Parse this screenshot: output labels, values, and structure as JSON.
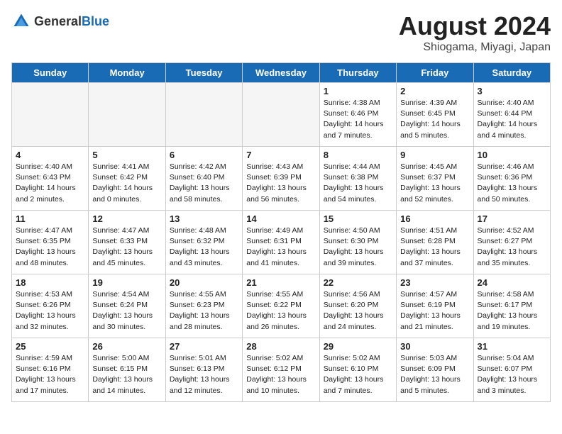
{
  "header": {
    "logo_general": "General",
    "logo_blue": "Blue",
    "title": "August 2024",
    "subtitle": "Shiogama, Miyagi, Japan"
  },
  "days_of_week": [
    "Sunday",
    "Monday",
    "Tuesday",
    "Wednesday",
    "Thursday",
    "Friday",
    "Saturday"
  ],
  "weeks": [
    [
      {
        "day": "",
        "empty": true
      },
      {
        "day": "",
        "empty": true
      },
      {
        "day": "",
        "empty": true
      },
      {
        "day": "",
        "empty": true
      },
      {
        "day": "1",
        "sunrise": "4:38 AM",
        "sunset": "6:46 PM",
        "daylight": "14 hours and 7 minutes."
      },
      {
        "day": "2",
        "sunrise": "4:39 AM",
        "sunset": "6:45 PM",
        "daylight": "14 hours and 5 minutes."
      },
      {
        "day": "3",
        "sunrise": "4:40 AM",
        "sunset": "6:44 PM",
        "daylight": "14 hours and 4 minutes."
      }
    ],
    [
      {
        "day": "4",
        "sunrise": "4:40 AM",
        "sunset": "6:43 PM",
        "daylight": "14 hours and 2 minutes."
      },
      {
        "day": "5",
        "sunrise": "4:41 AM",
        "sunset": "6:42 PM",
        "daylight": "14 hours and 0 minutes."
      },
      {
        "day": "6",
        "sunrise": "4:42 AM",
        "sunset": "6:40 PM",
        "daylight": "13 hours and 58 minutes."
      },
      {
        "day": "7",
        "sunrise": "4:43 AM",
        "sunset": "6:39 PM",
        "daylight": "13 hours and 56 minutes."
      },
      {
        "day": "8",
        "sunrise": "4:44 AM",
        "sunset": "6:38 PM",
        "daylight": "13 hours and 54 minutes."
      },
      {
        "day": "9",
        "sunrise": "4:45 AM",
        "sunset": "6:37 PM",
        "daylight": "13 hours and 52 minutes."
      },
      {
        "day": "10",
        "sunrise": "4:46 AM",
        "sunset": "6:36 PM",
        "daylight": "13 hours and 50 minutes."
      }
    ],
    [
      {
        "day": "11",
        "sunrise": "4:47 AM",
        "sunset": "6:35 PM",
        "daylight": "13 hours and 48 minutes."
      },
      {
        "day": "12",
        "sunrise": "4:47 AM",
        "sunset": "6:33 PM",
        "daylight": "13 hours and 45 minutes."
      },
      {
        "day": "13",
        "sunrise": "4:48 AM",
        "sunset": "6:32 PM",
        "daylight": "13 hours and 43 minutes."
      },
      {
        "day": "14",
        "sunrise": "4:49 AM",
        "sunset": "6:31 PM",
        "daylight": "13 hours and 41 minutes."
      },
      {
        "day": "15",
        "sunrise": "4:50 AM",
        "sunset": "6:30 PM",
        "daylight": "13 hours and 39 minutes."
      },
      {
        "day": "16",
        "sunrise": "4:51 AM",
        "sunset": "6:28 PM",
        "daylight": "13 hours and 37 minutes."
      },
      {
        "day": "17",
        "sunrise": "4:52 AM",
        "sunset": "6:27 PM",
        "daylight": "13 hours and 35 minutes."
      }
    ],
    [
      {
        "day": "18",
        "sunrise": "4:53 AM",
        "sunset": "6:26 PM",
        "daylight": "13 hours and 32 minutes."
      },
      {
        "day": "19",
        "sunrise": "4:54 AM",
        "sunset": "6:24 PM",
        "daylight": "13 hours and 30 minutes."
      },
      {
        "day": "20",
        "sunrise": "4:55 AM",
        "sunset": "6:23 PM",
        "daylight": "13 hours and 28 minutes."
      },
      {
        "day": "21",
        "sunrise": "4:55 AM",
        "sunset": "6:22 PM",
        "daylight": "13 hours and 26 minutes."
      },
      {
        "day": "22",
        "sunrise": "4:56 AM",
        "sunset": "6:20 PM",
        "daylight": "13 hours and 24 minutes."
      },
      {
        "day": "23",
        "sunrise": "4:57 AM",
        "sunset": "6:19 PM",
        "daylight": "13 hours and 21 minutes."
      },
      {
        "day": "24",
        "sunrise": "4:58 AM",
        "sunset": "6:17 PM",
        "daylight": "13 hours and 19 minutes."
      }
    ],
    [
      {
        "day": "25",
        "sunrise": "4:59 AM",
        "sunset": "6:16 PM",
        "daylight": "13 hours and 17 minutes."
      },
      {
        "day": "26",
        "sunrise": "5:00 AM",
        "sunset": "6:15 PM",
        "daylight": "13 hours and 14 minutes."
      },
      {
        "day": "27",
        "sunrise": "5:01 AM",
        "sunset": "6:13 PM",
        "daylight": "13 hours and 12 minutes."
      },
      {
        "day": "28",
        "sunrise": "5:02 AM",
        "sunset": "6:12 PM",
        "daylight": "13 hours and 10 minutes."
      },
      {
        "day": "29",
        "sunrise": "5:02 AM",
        "sunset": "6:10 PM",
        "daylight": "13 hours and 7 minutes."
      },
      {
        "day": "30",
        "sunrise": "5:03 AM",
        "sunset": "6:09 PM",
        "daylight": "13 hours and 5 minutes."
      },
      {
        "day": "31",
        "sunrise": "5:04 AM",
        "sunset": "6:07 PM",
        "daylight": "13 hours and 3 minutes."
      }
    ]
  ]
}
